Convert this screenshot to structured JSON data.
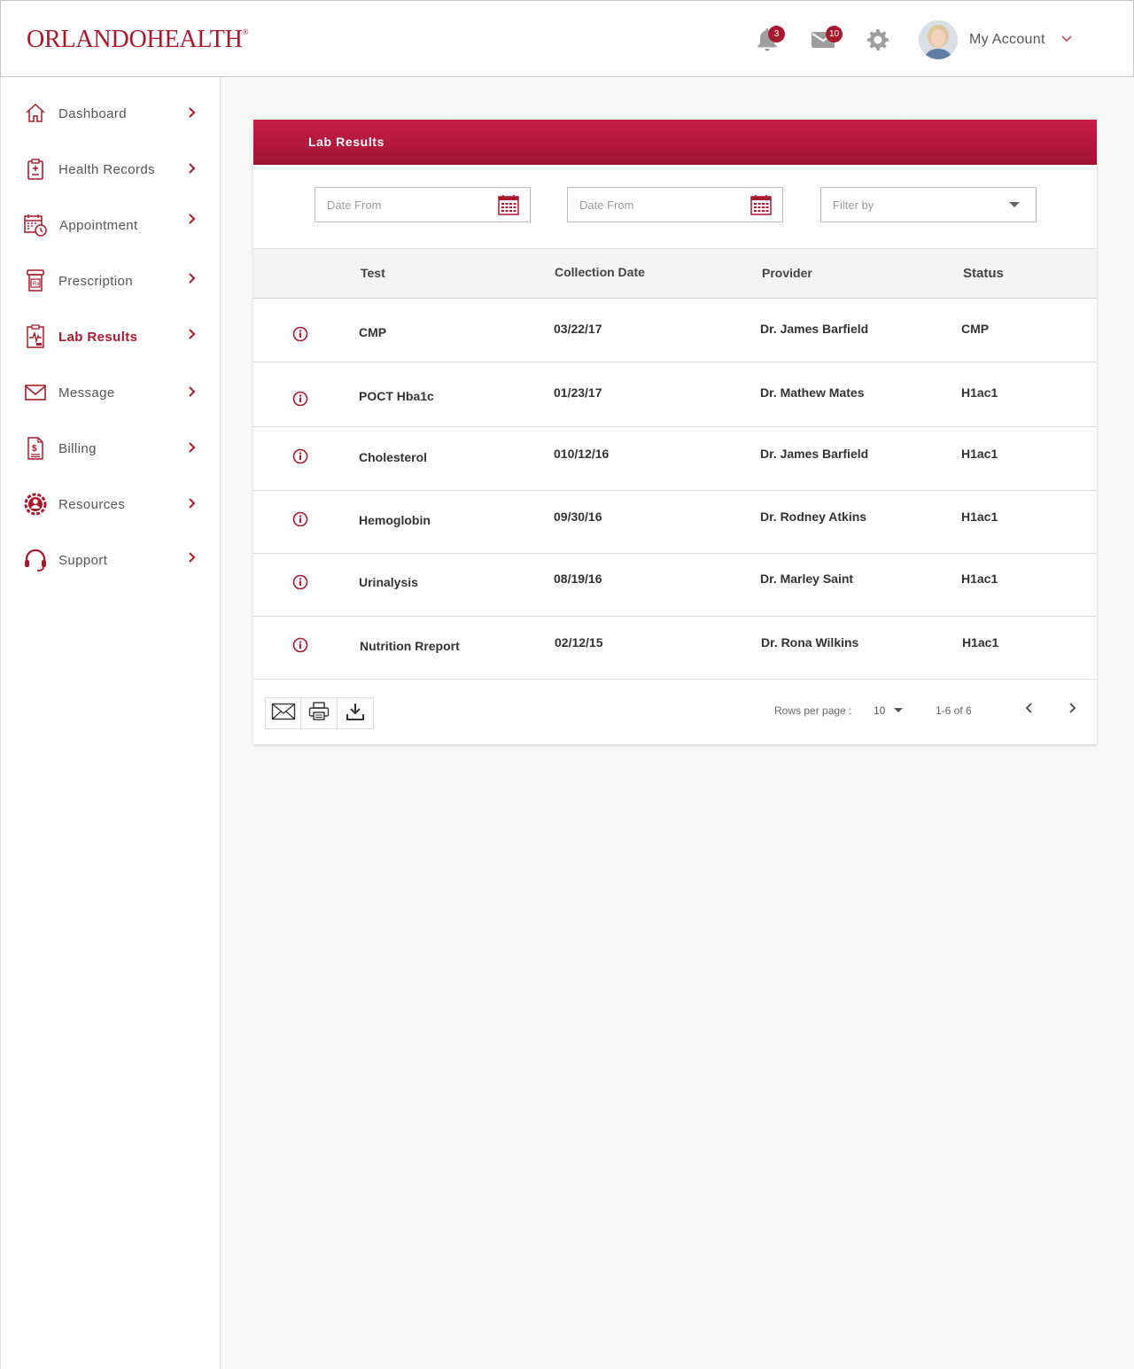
{
  "header": {
    "logo_part1": "ORLANDO",
    "logo_part2": "HEALTH",
    "logo_reg": "®",
    "notifications_count": "3",
    "messages_count": "10",
    "account_label": "My Account"
  },
  "sidebar": {
    "items": [
      {
        "label": "Dashboard",
        "icon": "home-icon"
      },
      {
        "label": "Health Records",
        "icon": "clipboard-icon"
      },
      {
        "label": "Appointment",
        "icon": "calendar-clock-icon"
      },
      {
        "label": "Prescription",
        "icon": "prescription-bottle-icon"
      },
      {
        "label": "Lab Results",
        "icon": "lab-report-icon",
        "active": true
      },
      {
        "label": "Message",
        "icon": "envelope-icon"
      },
      {
        "label": "Billing",
        "icon": "bill-icon"
      },
      {
        "label": "Resources",
        "icon": "resources-icon"
      },
      {
        "label": "Support",
        "icon": "headset-icon"
      }
    ]
  },
  "lab": {
    "title": "Lab Results",
    "filters": {
      "date_from_1": "Date From",
      "date_from_2": "Date From",
      "filter_by": "Filter by"
    },
    "columns": {
      "test": "Test",
      "collection_date": "Collection Date",
      "provider": "Provider",
      "status": "Status"
    },
    "rows": [
      {
        "test": "CMP",
        "date": "03/22/17",
        "provider": "Dr. James Barfield",
        "status": "CMP"
      },
      {
        "test": "POCT Hba1c",
        "date": "01/23/17",
        "provider": "Dr. Mathew Mates",
        "status": "H1ac1"
      },
      {
        "test": "Cholesterol",
        "date": "010/12/16",
        "provider": "Dr. James Barfield",
        "status": "H1ac1"
      },
      {
        "test": "Hemoglobin",
        "date": "09/30/16",
        "provider": "Dr. Rodney Atkins",
        "status": "H1ac1"
      },
      {
        "test": "Urinalysis",
        "date": "08/19/16",
        "provider": "Dr. Marley Saint",
        "status": "H1ac1"
      },
      {
        "test": "Nutrition Rreport",
        "date": "02/12/15",
        "provider": "Dr. Rona Wilkins",
        "status": "H1ac1"
      }
    ],
    "pagination": {
      "rows_per_page_label": "Rows per page :",
      "rows_per_page_value": "10",
      "range": "1-6 of 6"
    }
  },
  "colors": {
    "brand": "#a6192e",
    "header_gradient_top": "#c81e48",
    "header_gradient_bottom": "#9f1431"
  }
}
